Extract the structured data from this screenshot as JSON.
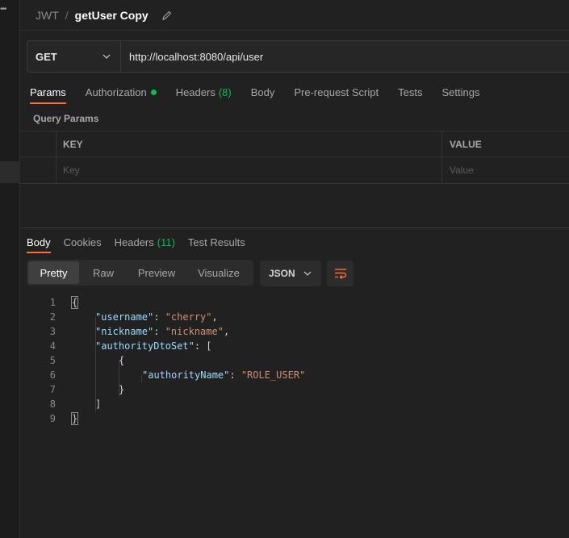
{
  "breadcrumb": {
    "root": "JWT",
    "separator": "/",
    "current": "getUser Copy"
  },
  "request": {
    "method": "GET",
    "url": "http://localhost:8080/api/user"
  },
  "request_tabs": [
    {
      "label": "Params",
      "active": true
    },
    {
      "label": "Authorization"
    },
    {
      "label": "Headers",
      "count": "(8)"
    },
    {
      "label": "Body"
    },
    {
      "label": "Pre-request Script"
    },
    {
      "label": "Tests"
    },
    {
      "label": "Settings"
    }
  ],
  "query_params": {
    "title": "Query Params",
    "headers": {
      "key": "KEY",
      "value": "VALUE"
    },
    "placeholders": {
      "key": "Key",
      "value": "Value"
    }
  },
  "response_tabs": [
    {
      "label": "Body",
      "active": true
    },
    {
      "label": "Cookies"
    },
    {
      "label": "Headers",
      "count": "(11)"
    },
    {
      "label": "Test Results"
    }
  ],
  "view_modes": [
    "Pretty",
    "Raw",
    "Preview",
    "Visualize"
  ],
  "format": "JSON",
  "response_body": {
    "line_numbers": [
      "1",
      "2",
      "3",
      "4",
      "5",
      "6",
      "7",
      "8",
      "9"
    ],
    "username_key": "\"username\"",
    "username_value": "\"cherry\"",
    "nickname_key": "\"nickname\"",
    "nickname_value": "\"nickname\"",
    "authority_set_key": "\"authorityDtoSet\"",
    "authority_name_key": "\"authorityName\"",
    "authority_name_value": "\"ROLE_USER\""
  },
  "colors": {
    "accent": "#ff6c37",
    "success": "#0cbb52",
    "json_key": "#9cdcfe",
    "json_string": "#ce9178"
  }
}
